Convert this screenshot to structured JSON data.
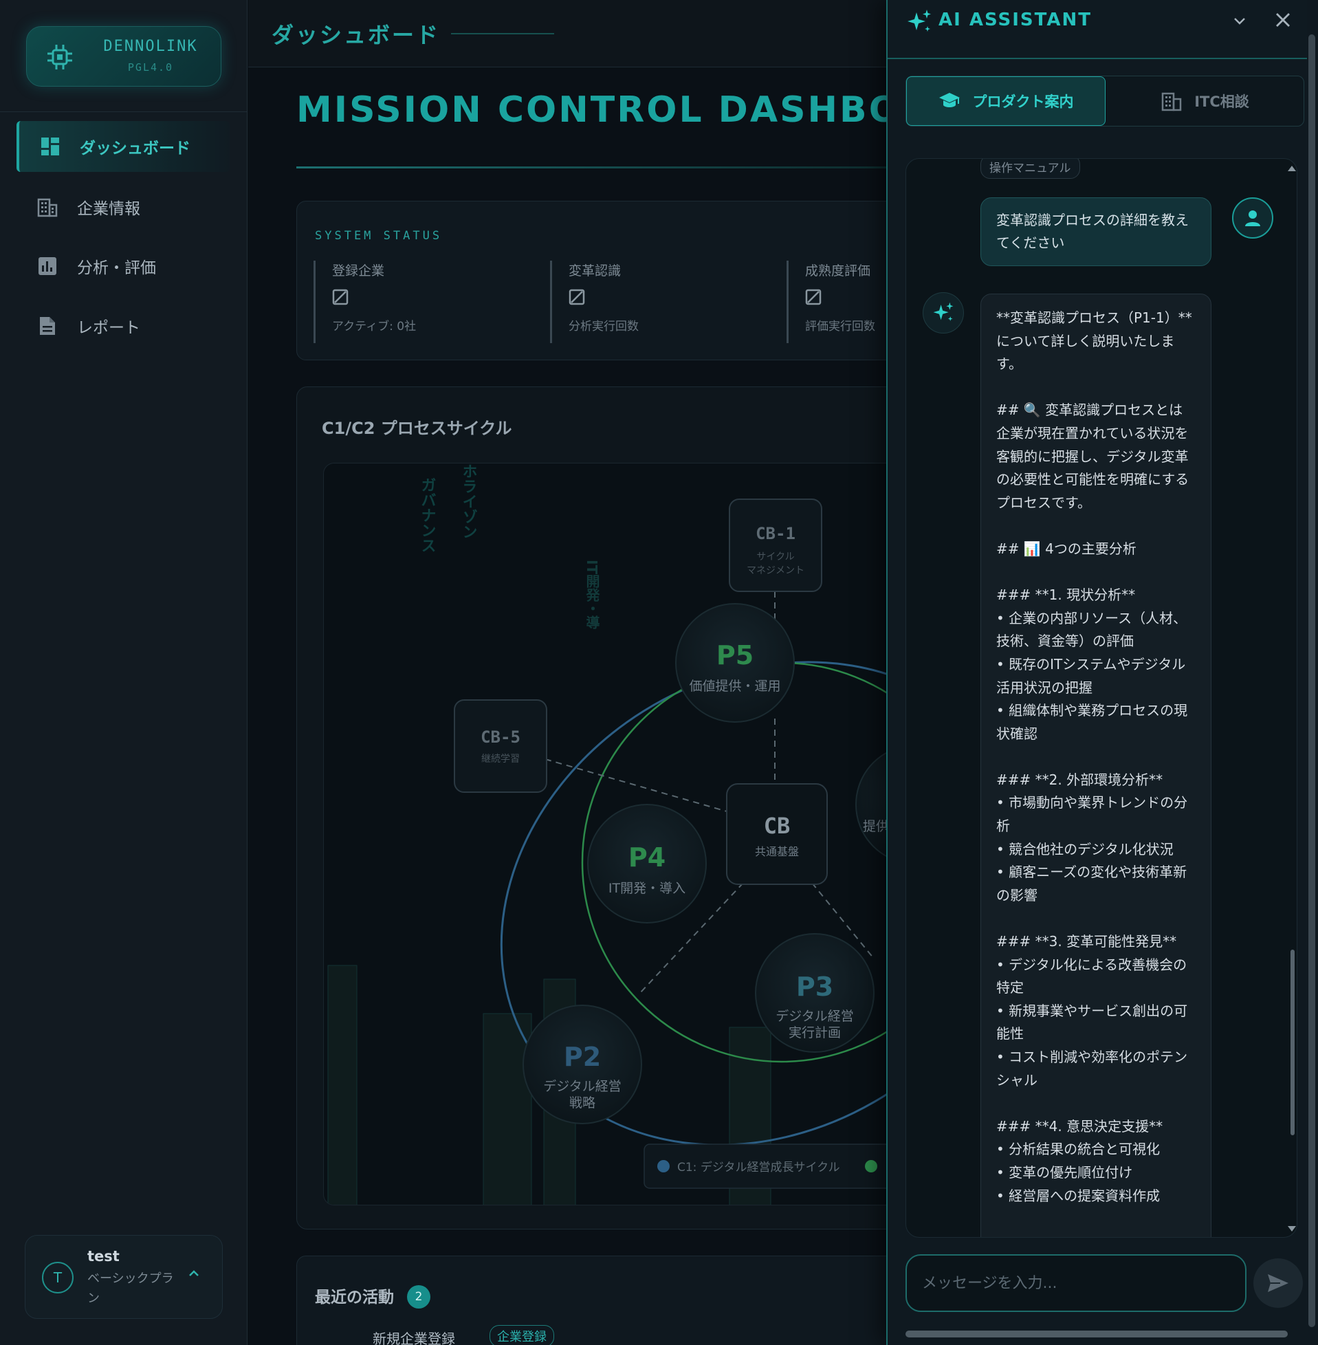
{
  "brand": {
    "name": "DENNOLINK",
    "version": "PGL4.0"
  },
  "sidebar": {
    "items": [
      {
        "label": "ダッシュボード",
        "icon": "dashboard-icon",
        "active": true
      },
      {
        "label": "企業情報",
        "icon": "building-icon",
        "active": false
      },
      {
        "label": "分析・評価",
        "icon": "chart-icon",
        "active": false
      },
      {
        "label": "レポート",
        "icon": "document-icon",
        "active": false
      }
    ],
    "user": {
      "initial": "T",
      "name": "test",
      "plan": "ベーシックプラン"
    }
  },
  "topbar": {
    "title": "ダッシュボード"
  },
  "hero": {
    "title": "MISSION CONTROL DASHBOARD"
  },
  "status": {
    "label": "SYSTEM STATUS",
    "stats": [
      {
        "title": "登録企業",
        "sub": "アクティブ: 0社"
      },
      {
        "title": "変革認識",
        "sub": "分析実行回数"
      },
      {
        "title": "成熟度評価",
        "sub": "評価実行回数"
      }
    ]
  },
  "cycle": {
    "title": "C1/C2 プロセスサイクル",
    "nodes": {
      "cb1": {
        "code": "CB-1",
        "label": "サイクルマネジメント"
      },
      "cb5": {
        "code": "CB-5",
        "label": "継続学習"
      },
      "cb": {
        "code": "CB",
        "label": "共通基盤"
      },
      "p5": {
        "code": "P5",
        "label": "価値提供・運用"
      },
      "p4": {
        "code": "P4",
        "label": "IT開発・導入"
      },
      "p3": {
        "code": "P3",
        "label": "デジタル経営実行計画"
      },
      "p2": {
        "code": "P2",
        "label": "デジタル経営戦略"
      },
      "p1_partial": "提供"
    },
    "vertical_labels": [
      "ガバナンス",
      "ホライゾン",
      "IT開発・導"
    ],
    "legend": "C1: デジタル経営成長サイクル"
  },
  "activity": {
    "title": "最近の活動",
    "count": "2",
    "row": {
      "title": "新規企業登録",
      "tag": "企業登録"
    }
  },
  "assistant": {
    "title": "AI ASSISTANT",
    "tabs": [
      {
        "label": "プロダクト案内",
        "active": true
      },
      {
        "label": "ITC相談",
        "active": false
      }
    ],
    "manual_tag": "操作マニュアル",
    "user_message": "変革認識プロセスの詳細を教えてください",
    "bot_message": "**変革認識プロセス（P1-1）**について詳しく説明いたします。\n\n## 🔍 変革認識プロセスとは\n企業が現在置かれている状況を客観的に把握し、デジタル変革の必要性と可能性を明確にするプロセスです。\n\n## 📊 4つの主要分析\n\n### **1. 現状分析**\n• 企業の内部リソース（人材、技術、資金等）の評価\n• 既存のITシステムやデジタル活用状況の把握\n• 組織体制や業務プロセスの現状確認\n\n### **2. 外部環境分析**\n• 市場動向や業界トレンドの分析\n• 競合他社のデジタル化状況\n• 顧客ニーズの変化や技術革新の影響\n\n### **3. 変革可能性発見**\n• デジタル化による改善機会の特定\n• 新規事業やサービス創出の可能性\n• コスト削減や効率化のポテンシャル\n\n### **4. 意思決定支援**\n• 分析結果の統合と可視化\n• 変革の優先順位付け\n• 経営層への提案資料作成",
    "input_placeholder": "メッセージを入力..."
  }
}
